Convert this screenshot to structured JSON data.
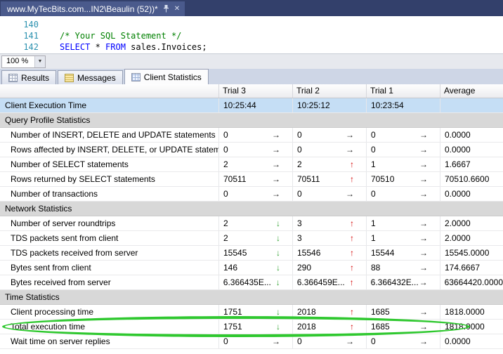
{
  "window": {
    "tab_title": "www.MyTecBits.com...IN2\\Beaulin (52))*"
  },
  "icons": {
    "up": "↑",
    "down": "↓",
    "same": "→",
    "chevron_down": "▼",
    "close": "✕"
  },
  "editor": {
    "zoom_level": "100 %",
    "lines": [
      {
        "number": "140",
        "segments": []
      },
      {
        "number": "141",
        "segments": [
          {
            "type": "comment",
            "text": "/* Your SQL Statement */"
          }
        ]
      },
      {
        "number": "142",
        "segments": [
          {
            "type": "keyword",
            "text": "SELECT"
          },
          {
            "type": "plain",
            "text": " * "
          },
          {
            "type": "keyword",
            "text": "FROM"
          },
          {
            "type": "plain",
            "text": " sales.Invoices;"
          }
        ]
      }
    ]
  },
  "result_tabs": [
    {
      "label": "Results",
      "icon": "results-grid-icon",
      "active": false
    },
    {
      "label": "Messages",
      "icon": "messages-icon",
      "active": false
    },
    {
      "label": "Client Statistics",
      "icon": "client-statistics-icon",
      "active": true
    }
  ],
  "table": {
    "columns": [
      "",
      "Trial 3",
      "Trial 2",
      "Trial 1",
      "Average"
    ],
    "rows": [
      {
        "type": "time",
        "label": "Client Execution Time",
        "values": [
          "10:25:44",
          "10:25:12",
          "10:23:54"
        ],
        "average": ""
      },
      {
        "type": "section",
        "label": "Query Profile Statistics"
      },
      {
        "type": "stat",
        "label": "Number of INSERT, DELETE and UPDATE statements",
        "trials": [
          {
            "value": "0",
            "trend": "same"
          },
          {
            "value": "0",
            "trend": "same"
          },
          {
            "value": "0",
            "trend": "same"
          }
        ],
        "average": "0.0000"
      },
      {
        "type": "stat",
        "label": "Rows affected by INSERT, DELETE, or UPDATE stateme...",
        "trials": [
          {
            "value": "0",
            "trend": "same"
          },
          {
            "value": "0",
            "trend": "same"
          },
          {
            "value": "0",
            "trend": "same"
          }
        ],
        "average": "0.0000"
      },
      {
        "type": "stat",
        "label": "Number of SELECT statements",
        "trials": [
          {
            "value": "2",
            "trend": "same"
          },
          {
            "value": "2",
            "trend": "up"
          },
          {
            "value": "1",
            "trend": "same"
          }
        ],
        "average": "1.6667"
      },
      {
        "type": "stat",
        "label": "Rows returned by SELECT statements",
        "trials": [
          {
            "value": "70511",
            "trend": "same"
          },
          {
            "value": "70511",
            "trend": "up"
          },
          {
            "value": "70510",
            "trend": "same"
          }
        ],
        "average": "70510.6600"
      },
      {
        "type": "stat",
        "label": "Number of transactions",
        "trials": [
          {
            "value": "0",
            "trend": "same"
          },
          {
            "value": "0",
            "trend": "same"
          },
          {
            "value": "0",
            "trend": "same"
          }
        ],
        "average": "0.0000"
      },
      {
        "type": "section",
        "label": "Network Statistics"
      },
      {
        "type": "stat",
        "label": "Number of server roundtrips",
        "trials": [
          {
            "value": "2",
            "trend": "down"
          },
          {
            "value": "3",
            "trend": "up"
          },
          {
            "value": "1",
            "trend": "same"
          }
        ],
        "average": "2.0000"
      },
      {
        "type": "stat",
        "label": "TDS packets sent from client",
        "trials": [
          {
            "value": "2",
            "trend": "down"
          },
          {
            "value": "3",
            "trend": "up"
          },
          {
            "value": "1",
            "trend": "same"
          }
        ],
        "average": "2.0000"
      },
      {
        "type": "stat",
        "label": "TDS packets received from server",
        "trials": [
          {
            "value": "15545",
            "trend": "down"
          },
          {
            "value": "15546",
            "trend": "up"
          },
          {
            "value": "15544",
            "trend": "same"
          }
        ],
        "average": "15545.0000"
      },
      {
        "type": "stat",
        "label": "Bytes sent from client",
        "trials": [
          {
            "value": "146",
            "trend": "down"
          },
          {
            "value": "290",
            "trend": "up"
          },
          {
            "value": "88",
            "trend": "same"
          }
        ],
        "average": "174.6667"
      },
      {
        "type": "stat",
        "label": "Bytes received from server",
        "trials": [
          {
            "value": "6.366435E...",
            "trend": "down"
          },
          {
            "value": "6.366459E...",
            "trend": "up"
          },
          {
            "value": "6.366432E...",
            "trend": "same"
          }
        ],
        "average": "63664420.0000"
      },
      {
        "type": "section",
        "label": "Time Statistics"
      },
      {
        "type": "stat",
        "label": "Client processing time",
        "trials": [
          {
            "value": "1751",
            "trend": "down"
          },
          {
            "value": "2018",
            "trend": "up"
          },
          {
            "value": "1685",
            "trend": "same"
          }
        ],
        "average": "1818.0000"
      },
      {
        "type": "stat",
        "label": "Total execution time",
        "circled": true,
        "trials": [
          {
            "value": "1751",
            "trend": "down"
          },
          {
            "value": "2018",
            "trend": "up"
          },
          {
            "value": "1685",
            "trend": "same"
          }
        ],
        "average": "1818.0000"
      },
      {
        "type": "stat",
        "label": "Wait time on server replies",
        "trials": [
          {
            "value": "0",
            "trend": "same"
          },
          {
            "value": "0",
            "trend": "same"
          },
          {
            "value": "0",
            "trend": "same"
          }
        ],
        "average": "0.0000"
      }
    ]
  },
  "annotation": {
    "shape": "ellipse",
    "color": "#2FC82F",
    "target": "Total execution time"
  },
  "colors": {
    "trend_up": "#D40000",
    "trend_down": "#2FA12F",
    "trend_same": "#141414",
    "selected_row": "#C5DEF5",
    "section_row": "#D8D8D8",
    "tab_strip": "#33406B",
    "doc_tab": "#4A5A8C"
  }
}
